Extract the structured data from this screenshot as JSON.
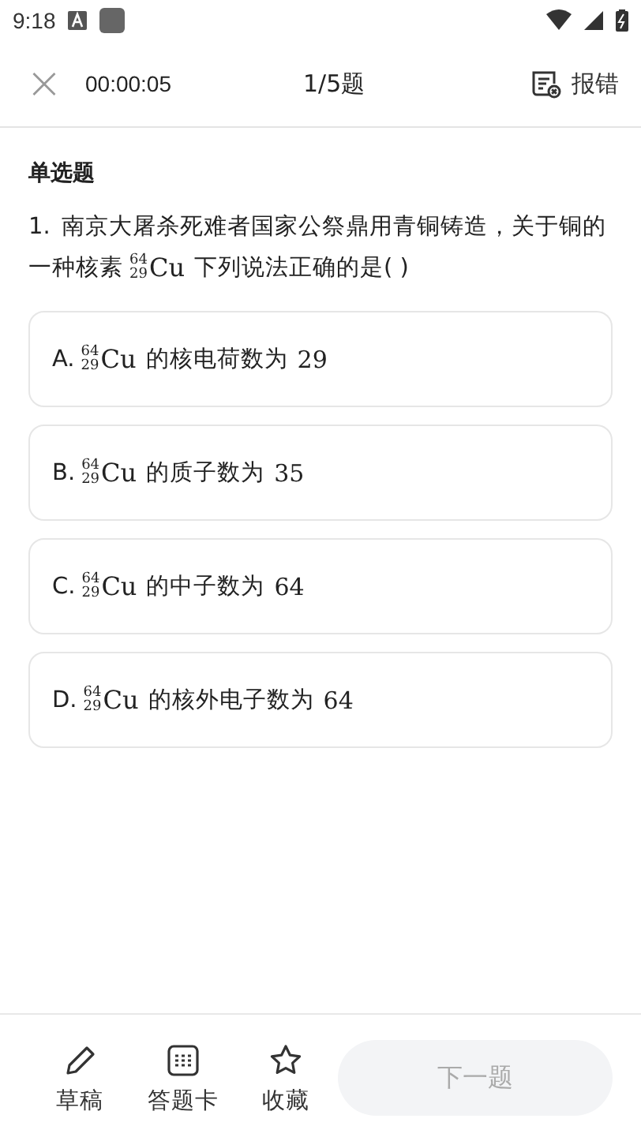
{
  "status_bar": {
    "time": "9:18"
  },
  "header": {
    "close": "×",
    "timer": "00:00:05",
    "progress": "1/5题",
    "report": "报错"
  },
  "question": {
    "type_label": "单选题",
    "number": "1.",
    "text_before": "南京大屠杀死难者国家公祭鼎用青铜铸造，关于铜的一种核素",
    "nuclide": {
      "mass": "64",
      "atomic": "29",
      "symbol": "Cu"
    },
    "text_after": "下列说法正确的是(      )"
  },
  "options": [
    {
      "label": "A.",
      "nuclide": {
        "mass": "64",
        "atomic": "29",
        "symbol": "Cu"
      },
      "text": "的核电荷数为",
      "value": "29",
      "selected": false
    },
    {
      "label": "B.",
      "nuclide": {
        "mass": "64",
        "atomic": "29",
        "symbol": "Cu"
      },
      "text": "的质子数为",
      "value": "35",
      "selected": false
    },
    {
      "label": "C.",
      "nuclide": {
        "mass": "64",
        "atomic": "29",
        "symbol": "Cu"
      },
      "text": "的中子数为",
      "value": "64",
      "selected": false
    },
    {
      "label": "D.",
      "nuclide": {
        "mass": "64",
        "atomic": "29",
        "symbol": "Cu"
      },
      "text": "的核外电子数为",
      "value": "64",
      "selected": false
    }
  ],
  "toolbar": [
    {
      "kind": "draft",
      "label": "草稿"
    },
    {
      "kind": "card",
      "label": "答题卡"
    },
    {
      "kind": "favorite",
      "label": "收藏"
    }
  ],
  "next_button": {
    "label": "下一题",
    "disabled": true
  }
}
